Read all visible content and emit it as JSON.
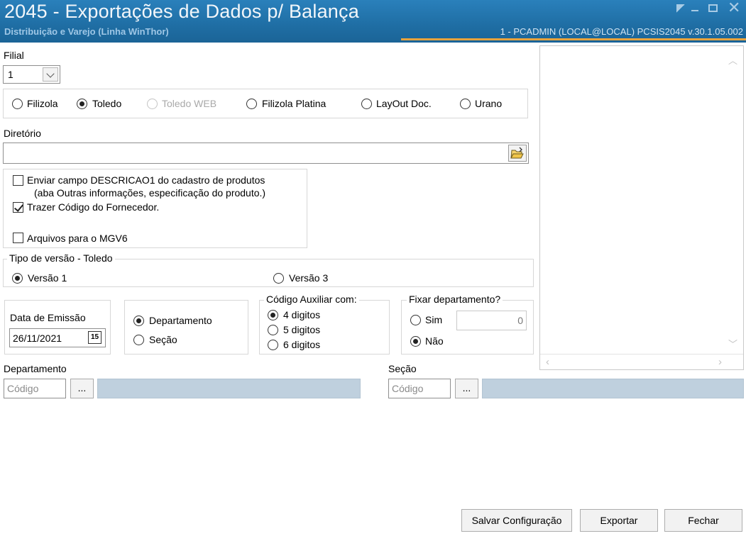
{
  "window": {
    "title": "2045 - Exportações de Dados p/ Balança",
    "subtitle": "Distribuição e Varejo (Linha WinThor)",
    "session_info": "1 - PCADMIN (LOCAL@LOCAL)  PCSIS2045  v.30.1.05.002"
  },
  "filial": {
    "label": "Filial",
    "value": "1"
  },
  "balanca": {
    "options": [
      {
        "label": "Filizola",
        "selected": false,
        "enabled": true
      },
      {
        "label": "Toledo",
        "selected": true,
        "enabled": true
      },
      {
        "label": "Toledo WEB",
        "selected": false,
        "enabled": false
      },
      {
        "label": "Filizola Platina",
        "selected": false,
        "enabled": true
      },
      {
        "label": "LayOut Doc.",
        "selected": false,
        "enabled": true
      },
      {
        "label": "Urano",
        "selected": false,
        "enabled": true
      }
    ]
  },
  "diretorio": {
    "label": "Diretório",
    "value": ""
  },
  "options": {
    "enviar_descricao": {
      "label": "Enviar campo DESCRICAO1 do cadastro de produtos",
      "label2": "(aba Outras informações, especificação do produto.)",
      "checked": false
    },
    "trazer_fornecedor": {
      "label": "Trazer Código do Fornecedor.",
      "checked": true
    },
    "arquivos_mgv6": {
      "label": "Arquivos para o MGV6",
      "checked": false
    }
  },
  "tipo_versao": {
    "legend": "Tipo de versão - Toledo",
    "options": [
      {
        "label": "Versão 1",
        "selected": true
      },
      {
        "label": "Versão 3",
        "selected": false
      }
    ]
  },
  "data_emissao": {
    "label": "Data de Emissão",
    "value": "26/11/2021",
    "calendar_glyph": "15"
  },
  "agrupamento": {
    "options": [
      {
        "label": "Departamento",
        "selected": true
      },
      {
        "label": "Seção",
        "selected": false
      }
    ]
  },
  "codigo_auxiliar": {
    "legend": "Código Auxiliar com:",
    "options": [
      {
        "label": "4 digitos",
        "selected": true
      },
      {
        "label": "5 digitos",
        "selected": false
      },
      {
        "label": "6 digitos",
        "selected": false
      }
    ]
  },
  "fixar_departamento": {
    "legend": "Fixar departamento?",
    "sim": {
      "label": "Sim",
      "selected": false
    },
    "nao": {
      "label": "Não",
      "selected": true
    },
    "value": "0"
  },
  "departamento": {
    "label": "Departamento",
    "code_placeholder": "Código",
    "lookup_label": "..."
  },
  "secao": {
    "label": "Seção",
    "code_placeholder": "Código",
    "lookup_label": "..."
  },
  "buttons": {
    "salvar": "Salvar Configuração",
    "exportar": "Exportar",
    "fechar": "Fechar"
  },
  "colors": {
    "titlebar": "#1f6ea4",
    "accent": "#e8a33c",
    "desc_field": "#bfd0de"
  }
}
